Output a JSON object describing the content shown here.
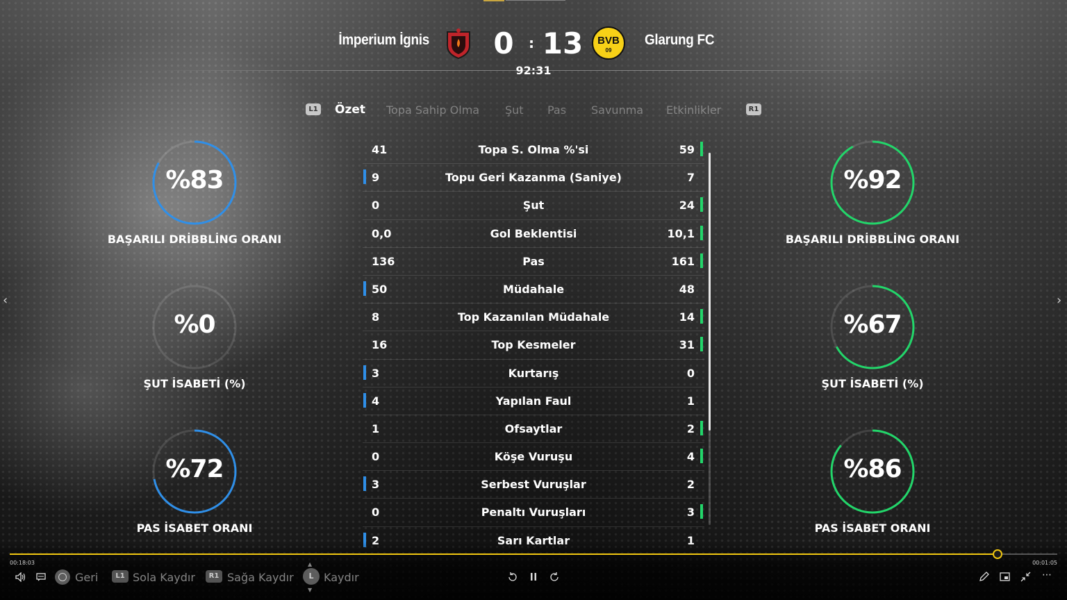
{
  "header": {
    "home_team": "İmperium İgnis",
    "away_team": "Glarung FC",
    "home_score": "0",
    "away_score": "13",
    "separator": ":",
    "match_time": "92:31",
    "away_crest_text": "BVB",
    "away_crest_sub": "09"
  },
  "tabs": {
    "prev_button": "L1",
    "next_button": "R1",
    "items": [
      "Özet",
      "Topa Sahip Olma",
      "Şut",
      "Pas",
      "Savunma",
      "Etkinlikler"
    ],
    "active": "Özet"
  },
  "stats": [
    {
      "label": "Topa S. Olma %'si",
      "home": "41",
      "away": "59",
      "leader": "away"
    },
    {
      "label": "Topu Geri Kazanma (Saniye)",
      "home": "9",
      "away": "7",
      "leader": "home"
    },
    {
      "label": "Şut",
      "home": "0",
      "away": "24",
      "leader": "away"
    },
    {
      "label": "Gol Beklentisi",
      "home": "0,0",
      "away": "10,1",
      "leader": "away"
    },
    {
      "label": "Pas",
      "home": "136",
      "away": "161",
      "leader": "away"
    },
    {
      "label": "Müdahale",
      "home": "50",
      "away": "48",
      "leader": "home"
    },
    {
      "label": "Top Kazanılan Müdahale",
      "home": "8",
      "away": "14",
      "leader": "away"
    },
    {
      "label": "Top Kesmeler",
      "home": "16",
      "away": "31",
      "leader": "away"
    },
    {
      "label": "Kurtarış",
      "home": "3",
      "away": "0",
      "leader": "home"
    },
    {
      "label": "Yapılan Faul",
      "home": "4",
      "away": "1",
      "leader": "home"
    },
    {
      "label": "Ofsaytlar",
      "home": "1",
      "away": "2",
      "leader": "away"
    },
    {
      "label": "Köşe Vuruşu",
      "home": "0",
      "away": "4",
      "leader": "away"
    },
    {
      "label": "Serbest Vuruşlar",
      "home": "3",
      "away": "2",
      "leader": "home"
    },
    {
      "label": "Penaltı Vuruşları",
      "home": "0",
      "away": "3",
      "leader": "away"
    },
    {
      "label": "Sarı Kartlar",
      "home": "2",
      "away": "1",
      "leader": "home"
    }
  ],
  "gauges": {
    "home": [
      {
        "value": 83,
        "text": "%83",
        "label": "BAŞARILI DRİBBLİNG ORANI"
      },
      {
        "value": 0,
        "text": "%0",
        "label": "ŞUT İSABETİ (%)"
      },
      {
        "value": 72,
        "text": "%72",
        "label": "PAS İSABET ORANI"
      }
    ],
    "away": [
      {
        "value": 92,
        "text": "%92",
        "label": "BAŞARILI DRİBBLİNG ORANI"
      },
      {
        "value": 67,
        "text": "%67",
        "label": "ŞUT İSABETİ (%)"
      },
      {
        "value": 86,
        "text": "%86",
        "label": "PAS İSABET ORANI"
      }
    ]
  },
  "colors": {
    "home_accent": "#2f8fe8",
    "away_accent": "#22d66a",
    "progress": "#f2c811"
  },
  "player": {
    "elapsed": "00:18:03",
    "remaining": "00:01:05",
    "progress": 0.942,
    "back_label": "Geri",
    "left_label": "Sola Kaydır",
    "right_label": "Sağa Kaydır",
    "scroll_label": "Kaydır",
    "l1": "L1",
    "r1": "R1",
    "stick": "L"
  }
}
